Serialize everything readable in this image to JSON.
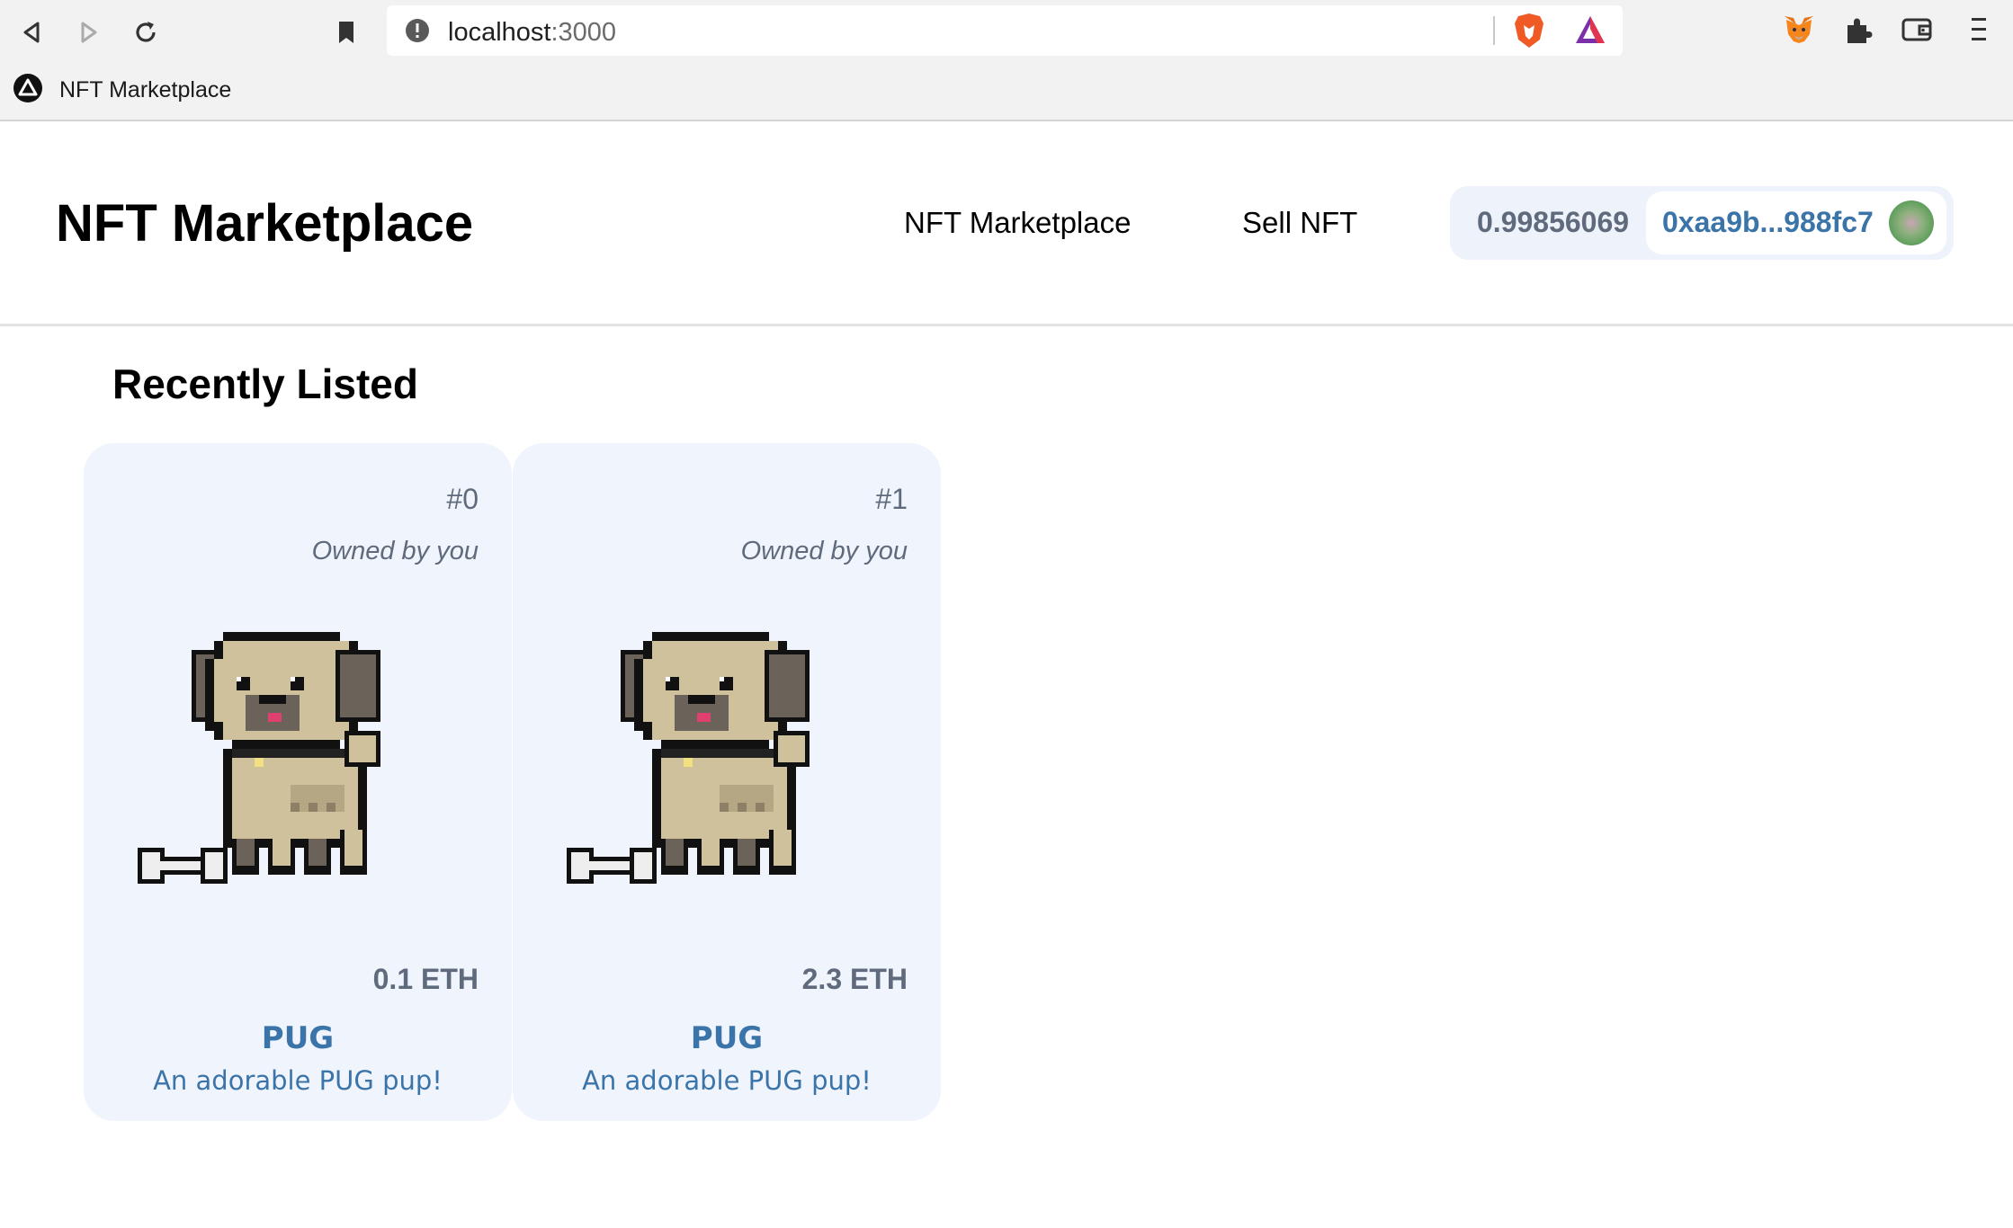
{
  "browser": {
    "url_host": "localhost",
    "url_port": ":3000",
    "tab_title": "NFT Marketplace",
    "icons": [
      "back-icon",
      "forward-icon",
      "reload-icon",
      "bookmark-icon",
      "info-icon",
      "brave-shield-icon",
      "brave-rewards-icon",
      "metamask-icon",
      "extensions-icon",
      "wallet-icon",
      "menu-icon"
    ]
  },
  "header": {
    "brand": "NFT Marketplace",
    "nav": [
      {
        "label": "NFT Marketplace"
      },
      {
        "label": "Sell NFT"
      }
    ],
    "wallet": {
      "balance": "0.99856069",
      "address": "0xaa9b...988fc7"
    }
  },
  "main": {
    "section_title": "Recently Listed",
    "cards": [
      {
        "token_id": "#0",
        "owner": "Owned by you",
        "price": "0.1 ETH",
        "name": "PUG",
        "description": "An adorable PUG pup!"
      },
      {
        "token_id": "#1",
        "owner": "Owned by you",
        "price": "2.3 ETH",
        "name": "PUG",
        "description": "An adorable PUG pup!"
      }
    ]
  },
  "colors": {
    "accent": "#3b74a9",
    "muted_text": "#5f6b7c",
    "card_bg": "#f0f5fd"
  }
}
